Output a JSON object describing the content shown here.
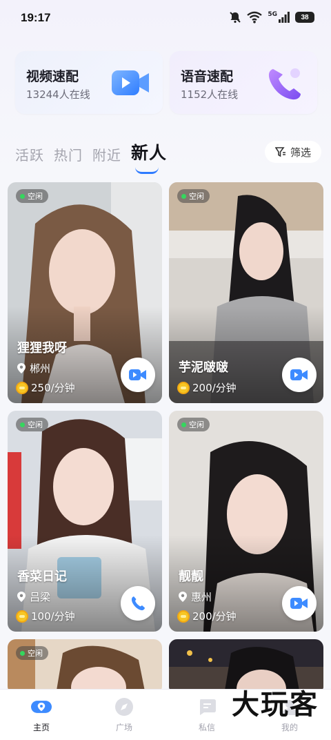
{
  "status": {
    "time": "19:17",
    "network_label": "5G",
    "battery": "38"
  },
  "match_cards": [
    {
      "title": "视频速配",
      "subtitle": "13244人在线",
      "icon": "video-camera-icon"
    },
    {
      "title": "语音速配",
      "subtitle": "1152人在线",
      "icon": "phone-icon"
    }
  ],
  "tabs": [
    {
      "label": "活跃",
      "active": false
    },
    {
      "label": "热门",
      "active": false
    },
    {
      "label": "附近",
      "active": false
    },
    {
      "label": "新人",
      "active": true
    }
  ],
  "filter": {
    "label": "筛选",
    "icon": "filter-icon"
  },
  "users": [
    {
      "status": "空闲",
      "name": "狸狸我呀",
      "location": "郴州",
      "price": "250/分钟",
      "call_type": "video"
    },
    {
      "status": "空闲",
      "name": "芋泥啵啵",
      "location": "",
      "price": "200/分钟",
      "call_type": "video"
    },
    {
      "status": "空闲",
      "name": "香菜日记",
      "location": "吕梁",
      "price": "100/分钟",
      "call_type": "voice"
    },
    {
      "status": "空闲",
      "name": "靓靓",
      "location": "惠州",
      "price": "200/分钟",
      "call_type": "video"
    },
    {
      "status": "空闲",
      "name": "",
      "location": "",
      "price": "",
      "call_type": ""
    },
    {
      "status": "",
      "name": "",
      "location": "",
      "price": "",
      "call_type": ""
    }
  ],
  "bottom_nav": [
    {
      "label": "主页",
      "icon": "home-location-icon",
      "active": true
    },
    {
      "label": "广场",
      "icon": "compass-icon",
      "active": false
    },
    {
      "label": "私信",
      "icon": "message-icon",
      "active": false
    },
    {
      "label": "我的",
      "icon": "profile-icon",
      "active": false
    }
  ],
  "watermark": "大玩客",
  "colors": {
    "accent": "#2e7bff",
    "online_dot": "#35d65e",
    "coin": "#f7c624"
  }
}
